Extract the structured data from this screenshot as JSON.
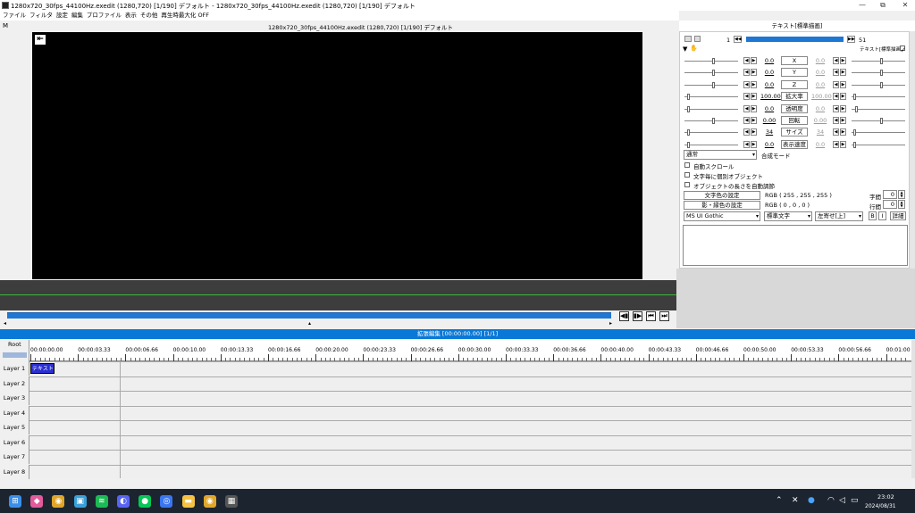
{
  "window": {
    "title": "1280x720_30fps_44100Hz.exedit (1280,720)  [1/190]  デフォルト - 1280x720_30fps_44100Hz.exedit (1280,720)  [1/190]  デフォルト"
  },
  "menu": [
    "ファイル",
    "フィルタ",
    "設定",
    "編集",
    "プロファイル",
    "表示",
    "その他",
    "再生時最大化 OFF"
  ],
  "preview": {
    "m_label": "M",
    "subtitle": "1280x720_30fps_44100Hz.exedit (1280,720)  [1/190]  デフォルト",
    "seek_left": "◂",
    "seek_mid": "▴",
    "seek_right": "▸"
  },
  "playback": {
    "prev_frame": "◀▮",
    "next_frame": "▮▶",
    "to_start": "⏮",
    "to_end": "⏭"
  },
  "object_panel": {
    "title": "テキスト[標準描画]",
    "frame_start": "1",
    "frame_end": "51",
    "filter_label": "テキスト[標準描画]",
    "params": [
      {
        "name": "X",
        "left": "0.0",
        "right": "0.0"
      },
      {
        "name": "Y",
        "left": "0.0",
        "right": "0.0"
      },
      {
        "name": "Z",
        "left": "0.0",
        "right": "0.0"
      },
      {
        "name": "拡大率",
        "left": "100.00",
        "right": "100.00"
      },
      {
        "name": "透明度",
        "left": "0.0",
        "right": "0.0"
      },
      {
        "name": "回転",
        "left": "0.00",
        "right": "0.00"
      },
      {
        "name": "サイズ",
        "left": "34",
        "right": "34"
      },
      {
        "name": "表示速度",
        "left": "0.0",
        "right": "0.0"
      }
    ],
    "blend_mode": "通常",
    "blend_label": "合成モード",
    "checkboxes": [
      "自動スクロール",
      "文字毎に個別オブジェクト",
      "オブジェクトの長さを自動調節"
    ],
    "text_color_btn": "文字色の設定",
    "text_color_val": "RGB ( 255 , 255 , 255 )",
    "shadow_color_btn": "影・縁色の設定",
    "shadow_color_val": "RGB ( 0 , 0 , 0 )",
    "char_spacing_label": "字間",
    "char_spacing": "0",
    "line_spacing_label": "行間",
    "line_spacing": "0",
    "font": "MS UI Gothic",
    "style": "標準文字",
    "align": "左寄せ[上]",
    "bold": "B",
    "italic": "I",
    "detail": "詳細"
  },
  "timeline": {
    "header": "拡張編集 [00:00:00.00] [1/1]",
    "root": "Root",
    "ticks": [
      "00:00:00.00",
      "00:00:03.33",
      "00:00:06.66",
      "00:00:10.00",
      "00:00:13.33",
      "00:00:16.66",
      "00:00:20.00",
      "00:00:23.33",
      "00:00:26.66",
      "00:00:30.00",
      "00:00:33.33",
      "00:00:36.66",
      "00:00:40.00",
      "00:00:43.33",
      "00:00:46.66",
      "00:00:50.00",
      "00:00:53.33",
      "00:00:56.66",
      "00:01:00"
    ],
    "layers": [
      "Layer 1",
      "Layer 2",
      "Layer 3",
      "Layer 4",
      "Layer 5",
      "Layer 6",
      "Layer 7",
      "Layer 8"
    ],
    "clip": "テキスト[標"
  },
  "taskbar": {
    "icons": [
      "windows-start-icon",
      "copilot-icon",
      "chrome-icon",
      "photos-icon",
      "spotify-icon",
      "discord-icon",
      "line-icon",
      "signal-icon",
      "file-explorer-icon",
      "chrome-icon-2",
      "aviutl-icon"
    ],
    "time": "23:02",
    "date": "2024/08/31"
  }
}
